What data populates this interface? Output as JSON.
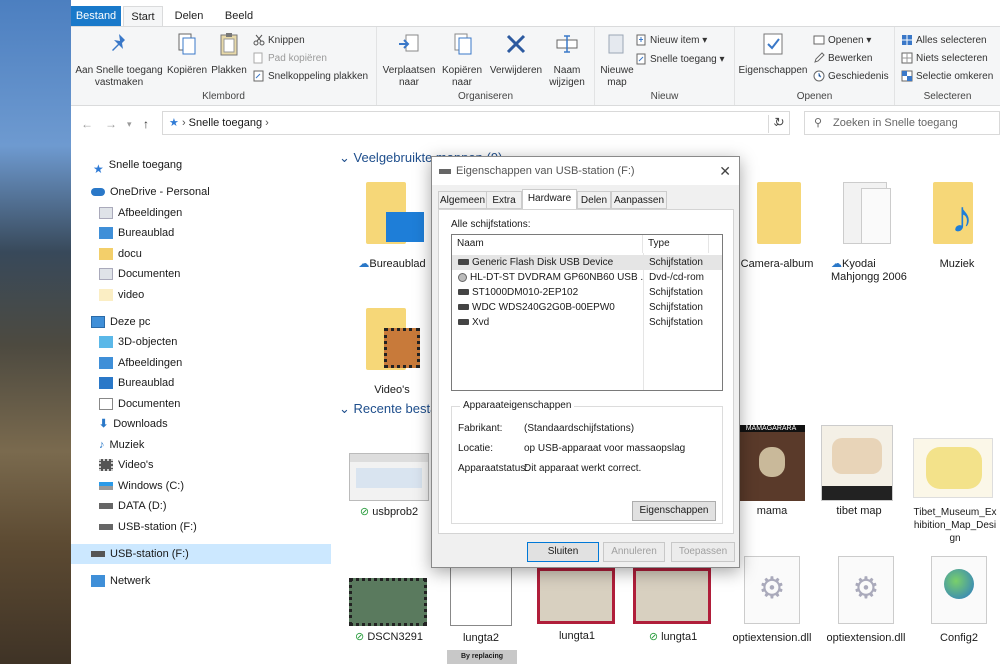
{
  "ribbon": {
    "tabs": [
      "Bestand",
      "Start",
      "Delen",
      "Beeld"
    ],
    "clipboard": {
      "pin": "Aan Snelle toegang vastmaken",
      "copy": "Kopiëren",
      "paste": "Plakken",
      "cut": "Knippen",
      "copy_path": "Pad kopiëren",
      "paste_shortcut": "Snelkoppeling plakken",
      "label": "Klembord"
    },
    "organize": {
      "move": "Verplaatsen naar",
      "copy_to": "Kopiëren naar",
      "delete": "Verwijderen",
      "rename": "Naam wijzigen",
      "label": "Organiseren"
    },
    "new": {
      "new_folder": "Nieuwe map",
      "new_item": "Nieuw item",
      "easy_access": "Snelle toegang",
      "label": "Nieuw"
    },
    "open": {
      "properties": "Eigenschappen",
      "open": "Openen",
      "edit": "Bewerken",
      "history": "Geschiedenis",
      "label": "Openen"
    },
    "select": {
      "all": "Alles selecteren",
      "none": "Niets selecteren",
      "invert": "Selectie omkeren",
      "label": "Selecteren"
    }
  },
  "address": {
    "path": "Snelle toegang",
    "search_placeholder": "Zoeken in Snelle toegang"
  },
  "nav": {
    "quick": "Snelle toegang",
    "onedrive": "OneDrive - Personal",
    "onedrive_items": [
      "Afbeeldingen",
      "Bureaublad",
      "docu",
      "Documenten",
      "video"
    ],
    "thispc": "Deze pc",
    "pc_items": [
      "3D-objecten",
      "Afbeeldingen",
      "Bureaublad",
      "Documenten",
      "Downloads",
      "Muziek",
      "Video's",
      "Windows (C:)",
      "DATA (D:)",
      "USB-station (F:)"
    ],
    "usb": "USB-station (F:)",
    "network": "Netwerk"
  },
  "content": {
    "frequent_header": "Veelgebruikte mappen (9)",
    "recent_header": "Recente bestanden (20)",
    "folders": [
      "Bureaublad",
      "Camera-album",
      "Kyodai Mahjongg 2006",
      "Muziek",
      "Video's"
    ],
    "recent_row1": [
      "usbprob2",
      "mama",
      "tibet map",
      "Tibet_Museum_Exhibition_Map_Design"
    ],
    "recent_row2": [
      "DSCN3291",
      "lungta2",
      "lungta1",
      "lungta1",
      "optiextension.dll",
      "optiextension.dll",
      "Config2"
    ],
    "thumb_caption_mama": "MAMAGARARA",
    "thumb_caption_replacing": "By replacing"
  },
  "dialog": {
    "title": "Eigenschappen van USB-station (F:)",
    "tabs": [
      "Algemeen",
      "Extra",
      "Hardware",
      "Delen",
      "Aanpassen"
    ],
    "all_drives": "Alle schijfstations:",
    "col_name": "Naam",
    "col_type": "Type",
    "drives": [
      {
        "name": "Generic Flash Disk USB Device",
        "type": "Schijfstation"
      },
      {
        "name": "HL-DT-ST DVDRAM GP60NB60 USB ...",
        "type": "Dvd-/cd-rom"
      },
      {
        "name": "ST1000DM010-2EP102",
        "type": "Schijfstation"
      },
      {
        "name": "WDC WDS240G2G0B-00EPW0",
        "type": "Schijfstation"
      },
      {
        "name": "Xvd",
        "type": "Schijfstation"
      }
    ],
    "device_props": "Apparaateigenschappen",
    "manufacturer_label": "Fabrikant:",
    "manufacturer": "(Standaardschijfstations)",
    "location_label": "Locatie:",
    "location": "op USB-apparaat voor massaopslag",
    "status_label": "Apparaatstatus:",
    "status": "Dit apparaat werkt correct.",
    "props_button": "Eigenschappen",
    "close": "Sluiten",
    "cancel": "Annuleren",
    "apply": "Toepassen"
  }
}
